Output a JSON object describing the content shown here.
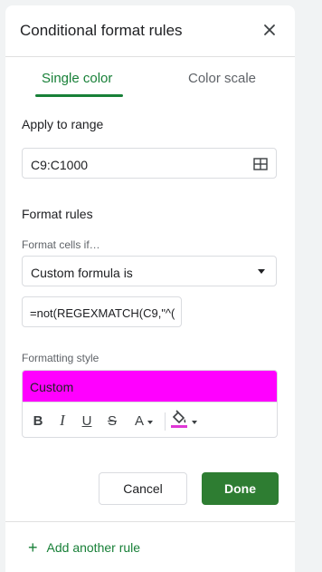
{
  "header": {
    "title": "Conditional format rules"
  },
  "tabs": [
    {
      "label": "Single color",
      "active": true
    },
    {
      "label": "Color scale",
      "active": false
    }
  ],
  "range": {
    "label": "Apply to range",
    "value": "C9:C1000"
  },
  "format_rules": {
    "label": "Format rules",
    "condition_label": "Format cells if…",
    "condition_value": "Custom formula is",
    "formula_value": "=not(REGEXMATCH(C9,\"^("
  },
  "formatting_style": {
    "label": "Formatting style",
    "preview_text": "Custom",
    "preview_color": "#ff00ff",
    "toolbar": {
      "bold": "B",
      "italic": "I",
      "underline": "U",
      "strikethrough": "S",
      "text_color": "A",
      "fill_color_swatch": "#e037d6"
    }
  },
  "actions": {
    "cancel": "Cancel",
    "done": "Done"
  },
  "footer": {
    "add_rule": "Add another rule"
  },
  "colors": {
    "accent": "#188038",
    "done_button": "#2e7d32"
  }
}
